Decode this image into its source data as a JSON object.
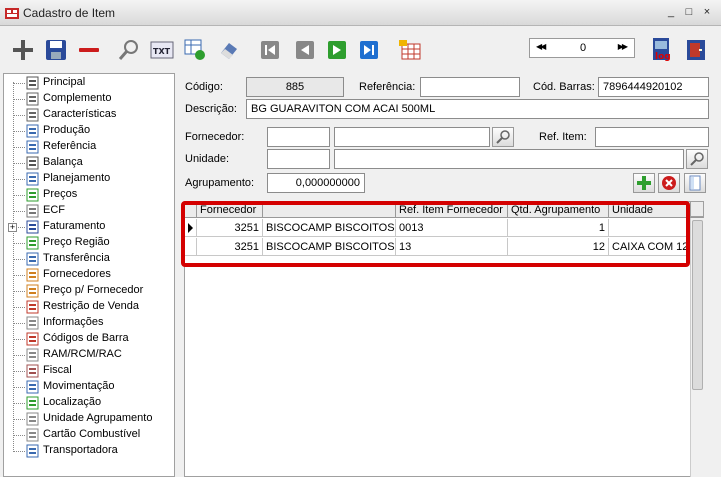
{
  "window": {
    "title": "Cadastro de Item",
    "minimize": "_",
    "maximize": "□",
    "close": "×"
  },
  "toolbar": {
    "icons": [
      "add-icon",
      "save-icon",
      "remove-icon",
      "search-icon",
      "txt-export-icon",
      "grid-refresh-icon",
      "eraser-icon",
      "first-record-icon",
      "prev-record-icon",
      "next-record-icon",
      "last-record-icon",
      "table-view-icon",
      "log-icon",
      "exit-icon"
    ],
    "txt_label": "TXT",
    "log_label": "log",
    "nav_value": "0"
  },
  "tree": {
    "items": [
      {
        "label": "Principal",
        "icon": "list-icon"
      },
      {
        "label": "Complemento",
        "icon": "paperclip-icon"
      },
      {
        "label": "Características",
        "icon": "paperclip-icon"
      },
      {
        "label": "Produção",
        "icon": "production-icon"
      },
      {
        "label": "Referência",
        "icon": "reference-icon"
      },
      {
        "label": "Balança",
        "icon": "scale-icon"
      },
      {
        "label": "Planejamento",
        "icon": "planning-icon"
      },
      {
        "label": "Preços",
        "icon": "prices-icon"
      },
      {
        "label": "ECF",
        "icon": "printer-icon"
      },
      {
        "label": "Faturamento",
        "icon": "billing-icon"
      },
      {
        "label": "Preço Região",
        "icon": "region-price-icon"
      },
      {
        "label": "Transferência",
        "icon": "transfer-icon"
      },
      {
        "label": "Fornecedores",
        "icon": "suppliers-icon"
      },
      {
        "label": "Preço p/ Fornecedor",
        "icon": "supplier-price-icon"
      },
      {
        "label": "Restrição de Venda",
        "icon": "sale-restriction-icon"
      },
      {
        "label": "Informações",
        "icon": "info-icon"
      },
      {
        "label": "Códigos de Barra",
        "icon": "barcode-icon"
      },
      {
        "label": "RAM/RCM/RAC",
        "icon": "document-icon"
      },
      {
        "label": "Fiscal",
        "icon": "fiscal-icon"
      },
      {
        "label": "Movimentação",
        "icon": "movement-icon"
      },
      {
        "label": "Localização",
        "icon": "location-icon"
      },
      {
        "label": "Unidade Agrupamento",
        "icon": "document-icon"
      },
      {
        "label": "Cartão Combustível",
        "icon": "document-icon"
      },
      {
        "label": "Transportadora",
        "icon": "truck-icon"
      }
    ]
  },
  "form": {
    "codigo_label": "Código:",
    "codigo_value": "885",
    "referencia_label": "Referência:",
    "referencia_value": "",
    "cod_barras_label": "Cód. Barras:",
    "cod_barras_value": "7896444920102",
    "descricao_label": "Descrição:",
    "descricao_value": "BG GUARAVITON COM ACAI 500ML",
    "fornecedor_label": "Fornecedor:",
    "ref_item_label": "Ref. Item:",
    "unidade_label": "Unidade:",
    "agrupamento_label": "Agrupamento:",
    "agrupamento_value": "0,000000000"
  },
  "grid": {
    "columns": [
      "Fornecedor",
      "",
      "Ref. Item Fornecedor",
      "Qtd. Agrupamento",
      "Unidade"
    ],
    "rows": [
      {
        "fornecedor": "3251",
        "nome": "BISCOCAMP BISCOITOS",
        "ref": "0013",
        "qtd": "1",
        "unidade": ""
      },
      {
        "fornecedor": "3251",
        "nome": "BISCOCAMP BISCOITOS",
        "ref": "13",
        "qtd": "12",
        "unidade": "CAIXA COM 12"
      }
    ]
  },
  "colors": {
    "highlight": "#d40000",
    "add_green": "#2e9e2e",
    "remove_red": "#cc1c1c"
  }
}
